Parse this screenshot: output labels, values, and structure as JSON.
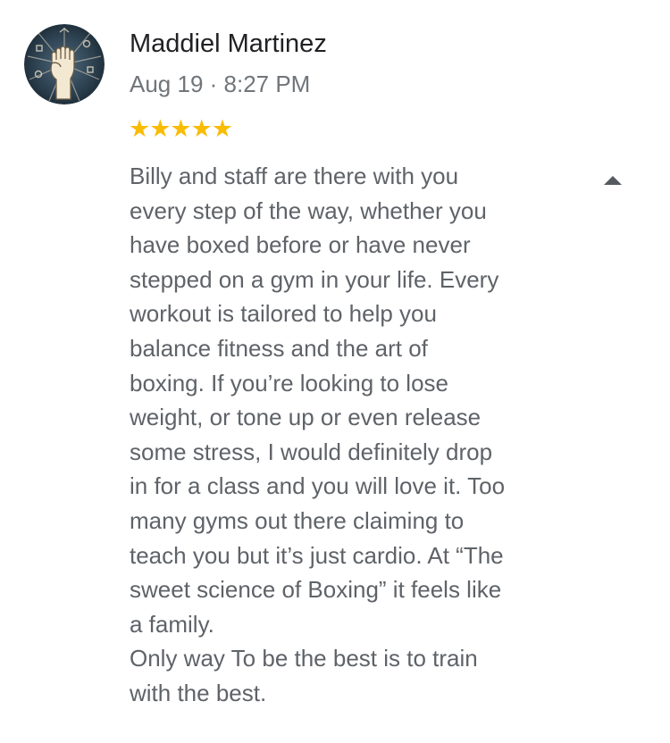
{
  "review": {
    "author": "Maddiel Martinez",
    "timestamp": "Aug 19 · 8:27 PM",
    "rating": 5,
    "rating_max": 5,
    "stars": "★★★★★",
    "avatar_icon": "raised-fist-icon",
    "collapse_icon": "caret-up-icon",
    "lines": [
      "Billy and staff are there with you",
      "every step of the way, whether you",
      "have boxed before or have never",
      "stepped on a gym in your life. Every",
      "workout is tailored to help you",
      "balance fitness and the art of",
      "boxing. If you’re looking to lose",
      "weight, or tone up or even release",
      "some stress, I would definitely drop",
      "in for a class and you will love it. Too",
      "many gyms out there claiming to",
      "teach you but it’s just cardio. At “The",
      "sweet science of Boxing” it feels like",
      "a family.",
      "Only way To be the best is to train",
      "with the best."
    ]
  },
  "colors": {
    "author": "#202124",
    "meta": "#70757a",
    "body": "#5f6368",
    "star": "#f9bc04",
    "caret": "#555b61"
  }
}
